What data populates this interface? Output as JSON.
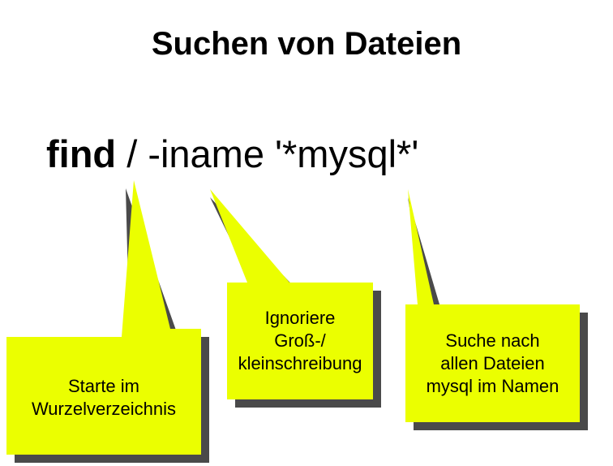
{
  "title": "Suchen von Dateien",
  "command": {
    "name": "find",
    "args": " / -iname '*mysql*'"
  },
  "callouts": [
    {
      "id": "root",
      "text": "Starte im\nWurzelverzeichnis"
    },
    {
      "id": "iname",
      "text": "Ignoriere\nGroß-/\nkleinschreibung"
    },
    {
      "id": "pattern",
      "text": "Suche nach\nallen Dateien\nmysql im Namen"
    }
  ],
  "colors": {
    "callout_fill": "#ebff00",
    "callout_shadow": "#4a4a4a",
    "text": "#000000"
  }
}
